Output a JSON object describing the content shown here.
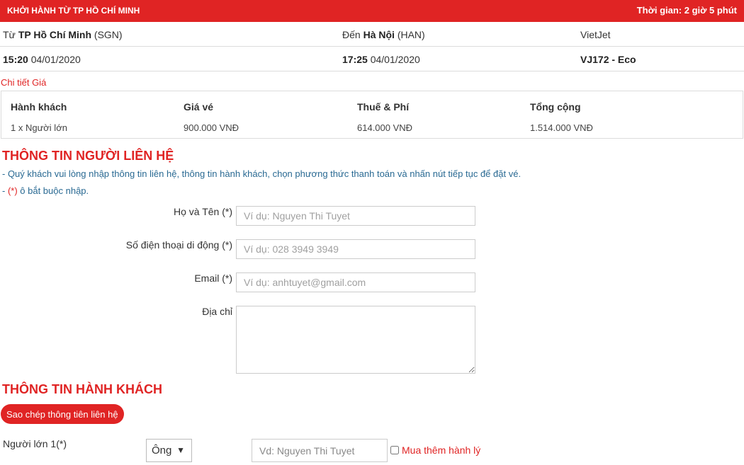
{
  "flight": {
    "header_title": "KHỞI HÀNH TỪ TP HỒ CHÍ MINH",
    "duration": "Thời gian: 2 giờ 5 phút",
    "from_prefix": "Từ",
    "from_city": "TP Hồ Chí Minh",
    "from_code": "(SGN)",
    "to_prefix": "Đến",
    "to_city": "Hà Nội",
    "to_code": "(HAN)",
    "airline": "VietJet",
    "depart_time": "15:20",
    "depart_date": "04/01/2020",
    "arrive_time": "17:25",
    "arrive_date": "04/01/2020",
    "flight_code": "VJ172 - Eco"
  },
  "price": {
    "title": "Chi tiết Giá",
    "headers": [
      "Hành khách",
      "Giá vé",
      "Thuế & Phí",
      "Tổng cộng"
    ],
    "row": [
      "1 x Người lớn",
      "900.000 VNĐ",
      "614.000 VNĐ",
      "1.514.000 VNĐ"
    ]
  },
  "contact": {
    "title": "THÔNG TIN NGƯỜI LIÊN HỆ",
    "note1": "- Quý khách vui lòng nhập thông tin liên hệ, thông tin hành khách, chọn phương thức thanh toán và nhấn nút tiếp tục để đặt vé.",
    "note2_prefix": "- ",
    "note2_req": "(*)",
    "note2_text": " ô bắt buộc nhập.",
    "fields": {
      "name_label": "Họ và Tên (*)",
      "name_placeholder": "Ví dụ: Nguyen Thi Tuyet",
      "phone_label": "Số điện thoại di động (*)",
      "phone_placeholder": "Ví dụ: 028 3949 3949",
      "email_label": "Email (*)",
      "email_placeholder": "Ví dụ: anhtuyet@gmail.com",
      "address_label": "Địa chỉ"
    }
  },
  "passenger": {
    "title": "THÔNG TIN HÀNH KHÁCH",
    "copy_button": "Sao chép thông tiên liên hệ",
    "adult_label": "Người lớn 1(*)",
    "title_value": "Ông",
    "name_placeholder": "Vd: Nguyen Thi Tuyet",
    "luggage_label": "Mua thêm hành lý"
  },
  "icons": {
    "dropdown": "caret-down-icon"
  },
  "colors": {
    "accent": "#e02424",
    "note": "#2a6a93"
  }
}
